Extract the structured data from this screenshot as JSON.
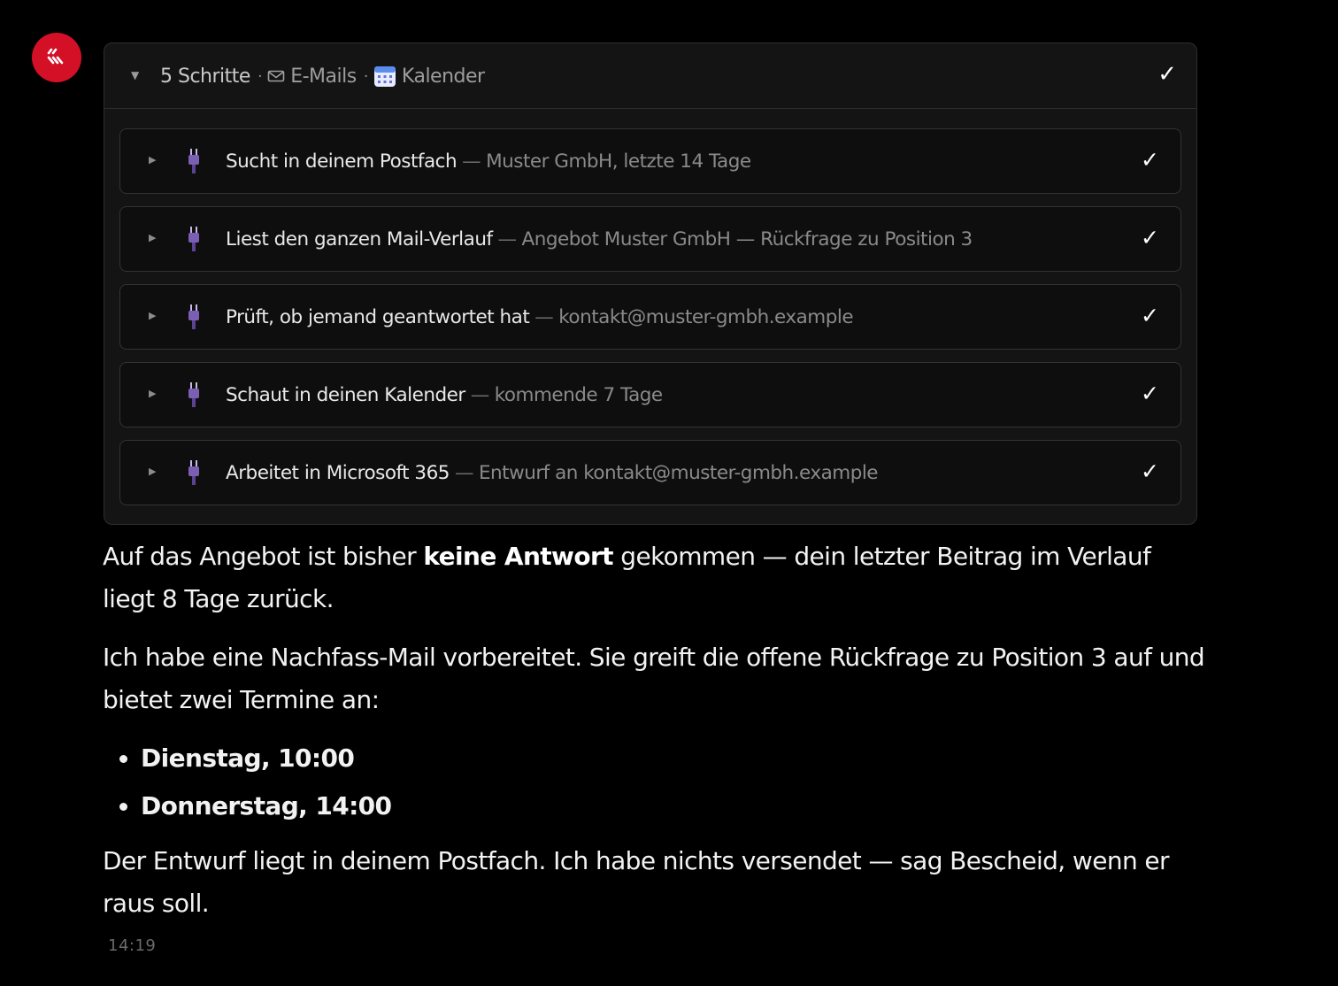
{
  "panel": {
    "steps_count": "5 Schritte",
    "chip_mail": "E-Mails",
    "chip_calendar": "Kalender",
    "status_check": "✓"
  },
  "steps": [
    {
      "action": "Sucht in deinem Postfach",
      "sep": "—",
      "detail": "Muster GmbH, letzte 14 Tage",
      "check": "✓"
    },
    {
      "action": "Liest den ganzen Mail-Verlauf",
      "sep": "—",
      "detail": "Angebot Muster GmbH — Rückfrage zu Position 3",
      "check": "✓"
    },
    {
      "action": "Prüft, ob jemand geantwortet hat",
      "sep": "—",
      "detail": "kontakt@muster-gmbh.example",
      "check": "✓"
    },
    {
      "action": "Schaut in deinen Kalender",
      "sep": "—",
      "detail": "kommende 7 Tage",
      "check": "✓"
    },
    {
      "action": "Arbeitet in Microsoft 365",
      "sep": "—",
      "detail": "Entwurf an kontakt@muster-gmbh.example",
      "check": "✓"
    }
  ],
  "message": {
    "p1_before": "Auf das Angebot ist bisher ",
    "p1_bold": "keine Antwort",
    "p1_after": " gekommen — dein letzter Beitrag im Verlauf liegt 8 Tage zurück.",
    "p2": "Ich habe eine Nachfass-Mail vorbereitet. Sie greift die offene Rückfrage zu Position 3 auf und bietet zwei Termine an:",
    "options": [
      "Dienstag, 10:00",
      "Donnerstag, 14:00"
    ],
    "p3": "Der Entwurf liegt in deinem Postfach. Ich habe nichts versendet — sag Bescheid, wenn er raus soll."
  },
  "timestamp": "14:19",
  "colors": {
    "background": "#000000",
    "avatar": "#d41027",
    "panel": "#141414",
    "plug": "#7b5fb3"
  }
}
